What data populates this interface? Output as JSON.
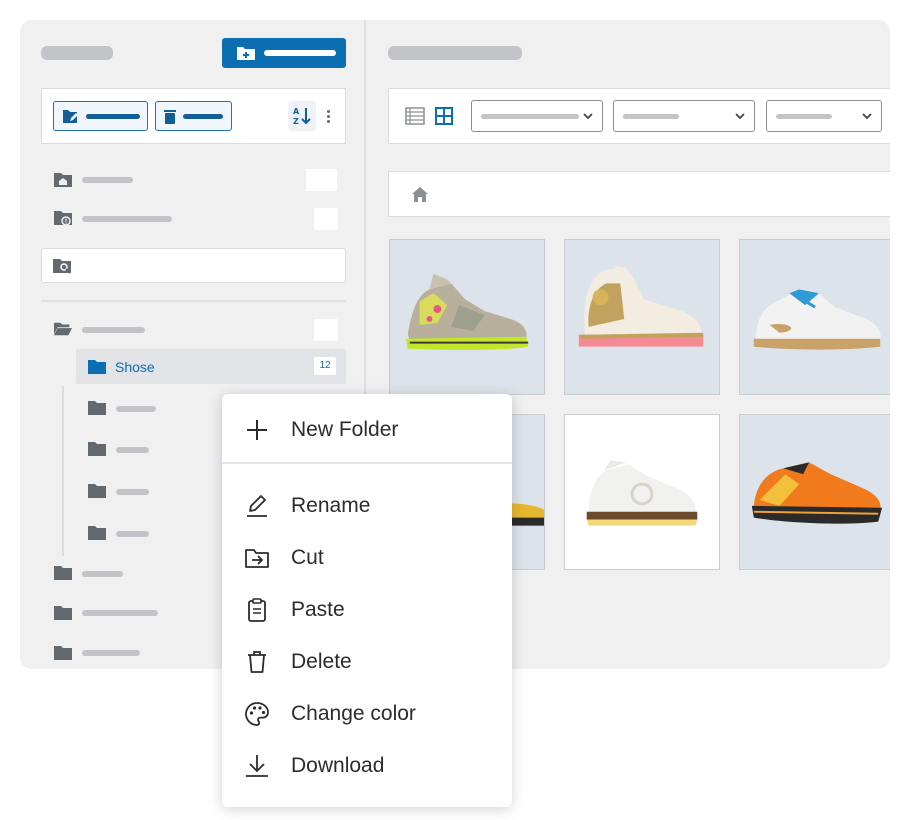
{
  "sidebar": {
    "active_folder": {
      "label": "Shose",
      "count": "12"
    },
    "icons": {
      "new_folder": "folder-plus-icon",
      "rename": "edit-icon",
      "delete": "trash-icon",
      "sort": "sort-az-icon",
      "more": "kebab-icon",
      "all_files": "home-folder-icon",
      "uncategorized": "folder-info-icon",
      "search": "search-folder-icon"
    }
  },
  "main": {
    "view_modes": [
      "list-view-icon",
      "grid-view-icon"
    ],
    "breadcrumb_icon": "home-icon",
    "grid": [
      "sneaker-1",
      "sneaker-2",
      "sneaker-3",
      "sneaker-4",
      "sneaker-5",
      "sneaker-6"
    ]
  },
  "context_menu": {
    "new_folder": "New Folder",
    "rename": "Rename",
    "cut": "Cut",
    "paste": "Paste",
    "delete": "Delete",
    "change_color": "Change color",
    "download": "Download"
  },
  "colors": {
    "accent": "#0a6eb0",
    "panel": "#f0f0f1",
    "folder_grey": "#646970"
  }
}
